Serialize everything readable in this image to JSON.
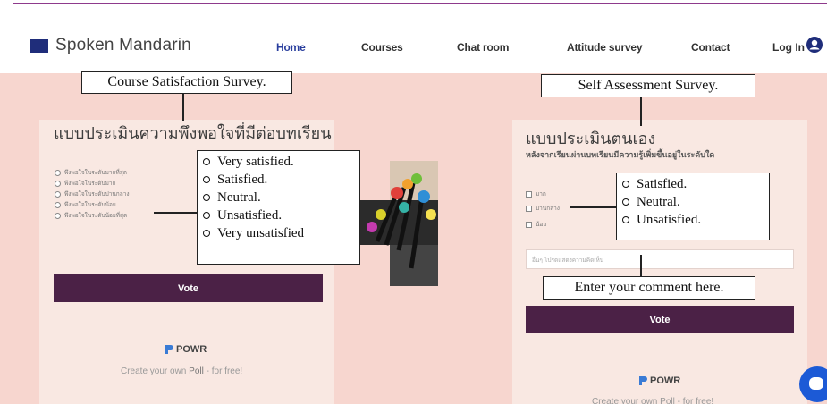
{
  "site": {
    "name": "Spoken Mandarin",
    "brand_color": "#1f2d7a",
    "accent": "#4b2146"
  },
  "nav": [
    {
      "label": "Home",
      "active": true
    },
    {
      "label": "Courses",
      "active": false
    },
    {
      "label": "Chat room",
      "active": false
    },
    {
      "label": "Attitude survey",
      "active": false
    },
    {
      "label": "Contact",
      "active": false
    }
  ],
  "auth": {
    "login_label": "Log In",
    "icon": "user-circle-icon"
  },
  "left_survey": {
    "annotation_title": "Course Satisfaction Survey.",
    "thai_title": "แบบประเมินความพึงพอใจที่มีต่อบทเรียน",
    "options": [
      "พึงพอใจในระดับมากที่สุด",
      "พึงพอใจในระดับมาก",
      "พึงพอใจในระดับปานกลาง",
      "พึงพอใจในระดับน้อย",
      "พึงพอใจในระดับน้อยที่สุด"
    ],
    "annotation_options": [
      "Very satisfied.",
      "Satisfied.",
      "Neutral.",
      "Unsatisfied.",
      "Very unsatisfied"
    ],
    "vote_label": "Vote",
    "powr_label": "POWR",
    "create_prefix": "Create your own ",
    "create_link": "Poll",
    "create_suffix": " - for free!"
  },
  "right_survey": {
    "annotation_title": "Self Assessment Survey.",
    "thai_title": "แบบประเมินตนเอง",
    "thai_question": "หลังจากเรียนผ่านบทเรียนมีความรู้เพิ่มขึ้นอยู่ในระดับใด",
    "options": [
      "มาก",
      "ปานกลาง",
      "น้อย"
    ],
    "annotation_options": [
      "Satisfied.",
      "Neutral.",
      "Unsatisfied."
    ],
    "comment_placeholder": "อื่นๆ โปรดแสดงความคิดเห็น",
    "comment_annotation": "Enter your comment here.",
    "vote_label": "Vote",
    "powr_label": "POWR",
    "create_text": "Create your own Poll - for free!"
  },
  "chat": {
    "icon": "chat-bubble-icon"
  }
}
